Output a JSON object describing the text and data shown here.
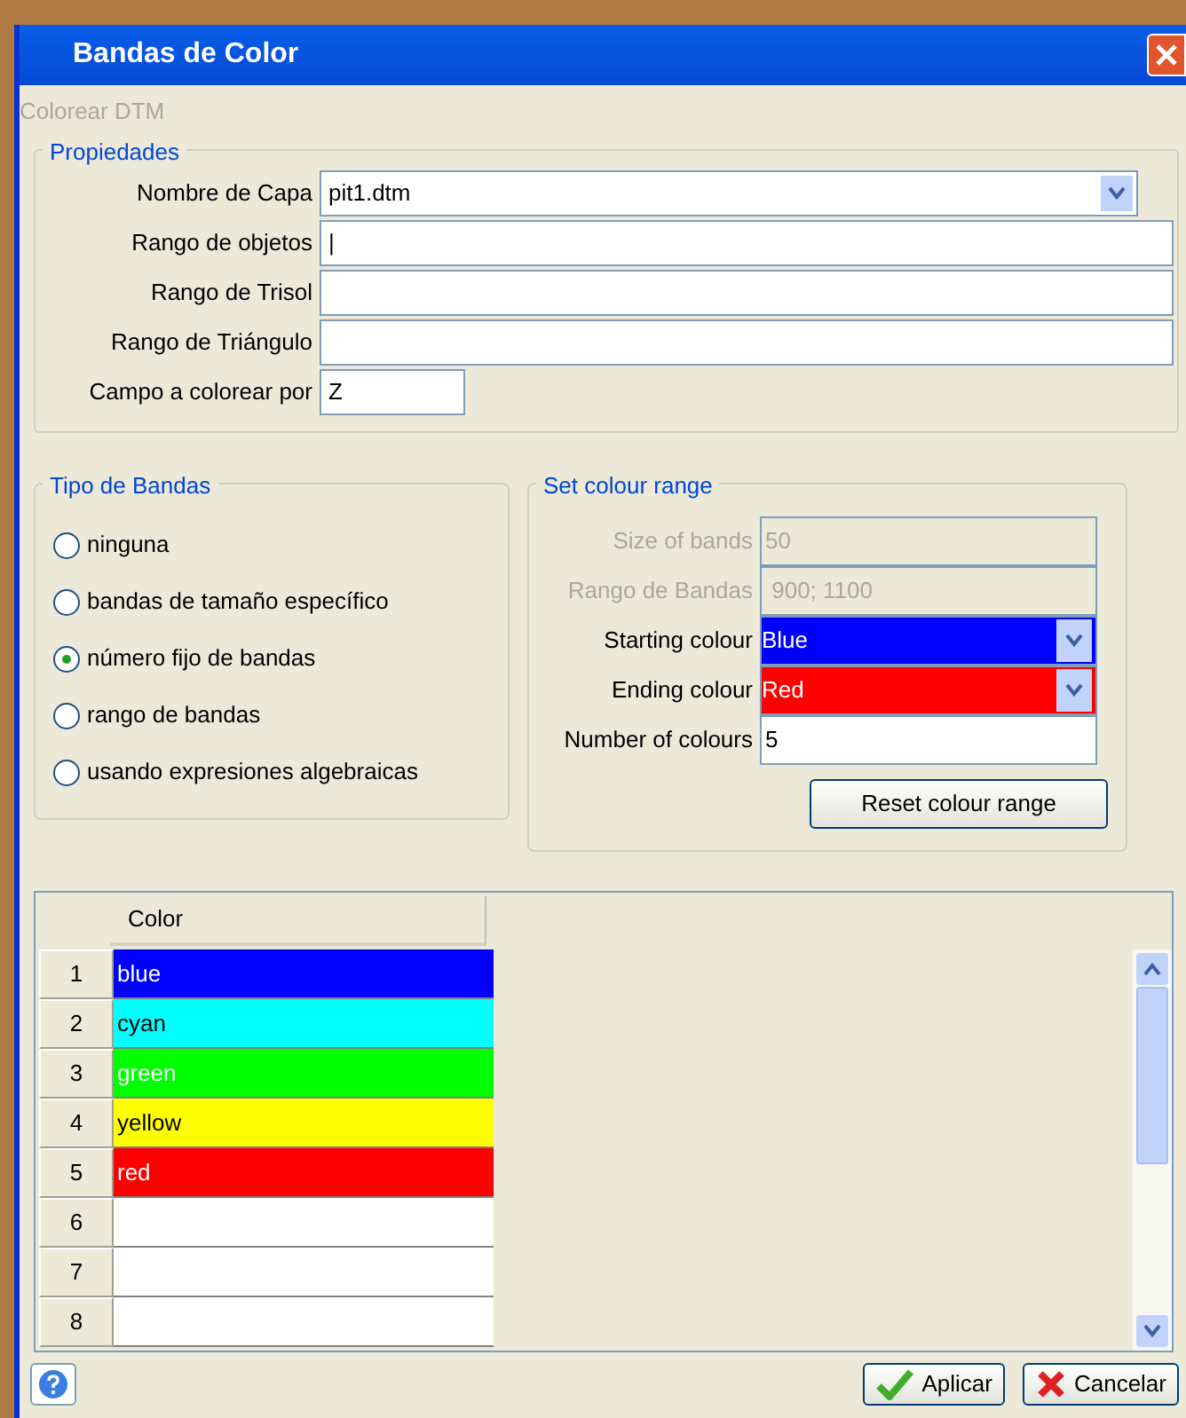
{
  "window": {
    "title": "Bandas de Color"
  },
  "section_title": "Colorear DTM",
  "properties": {
    "legend": "Propiedades",
    "fields": [
      {
        "kind": "dropdown",
        "label": "Nombre de Capa",
        "value": "pit1.dtm"
      },
      {
        "kind": "text",
        "label": "Rango de objetos",
        "value": "|"
      },
      {
        "kind": "text",
        "label": "Rango de Trisol"
      },
      {
        "kind": "text",
        "label": "Rango de Triángulo"
      },
      {
        "kind": "short",
        "label": "Campo a colorear por",
        "value": "Z"
      }
    ]
  },
  "band_type": {
    "legend": "Tipo de Bandas",
    "options": [
      {
        "label": "ninguna",
        "selected": false
      },
      {
        "label": "bandas de tamaño específico",
        "selected": false
      },
      {
        "label": "número fijo de bandas",
        "selected": true
      },
      {
        "label": "rango de bandas",
        "selected": false
      },
      {
        "label": "usando expresiones algebraicas",
        "selected": false
      }
    ]
  },
  "colour_range": {
    "legend": "Set colour range",
    "fields": [
      {
        "kind": "text",
        "label": "Size of bands",
        "value": "50",
        "disabled": true
      },
      {
        "kind": "text",
        "label": "Rango de Bandas",
        "value": " 900; 1100",
        "disabled": true
      },
      {
        "kind": "colour",
        "label": "Starting colour",
        "value": "Blue",
        "color": "#0000ff"
      },
      {
        "kind": "colour",
        "label": "Ending colour",
        "value": "Red",
        "color": "#ff0000"
      },
      {
        "kind": "text",
        "label": "Number of colours",
        "value": "5",
        "disabled": false
      }
    ],
    "button": "Reset colour range"
  },
  "table": {
    "columns": [
      "Color"
    ],
    "rows": [
      {
        "number": "1",
        "value": "blue",
        "color": "#0000ff"
      },
      {
        "number": "2",
        "value": "cyan",
        "color": "#00ffff"
      },
      {
        "number": "3",
        "value": "green",
        "color": "#00ff00"
      },
      {
        "number": "4",
        "value": "yellow",
        "color": "#ffff00"
      },
      {
        "number": "5",
        "value": "red",
        "color": "#ff0000"
      },
      {
        "number": "6"
      },
      {
        "number": "7"
      },
      {
        "number": "8"
      }
    ]
  },
  "buttons": [
    {
      "kind": "apply",
      "label": "Aplicar"
    },
    {
      "kind": "cancel",
      "label": "Cancelar"
    }
  ]
}
